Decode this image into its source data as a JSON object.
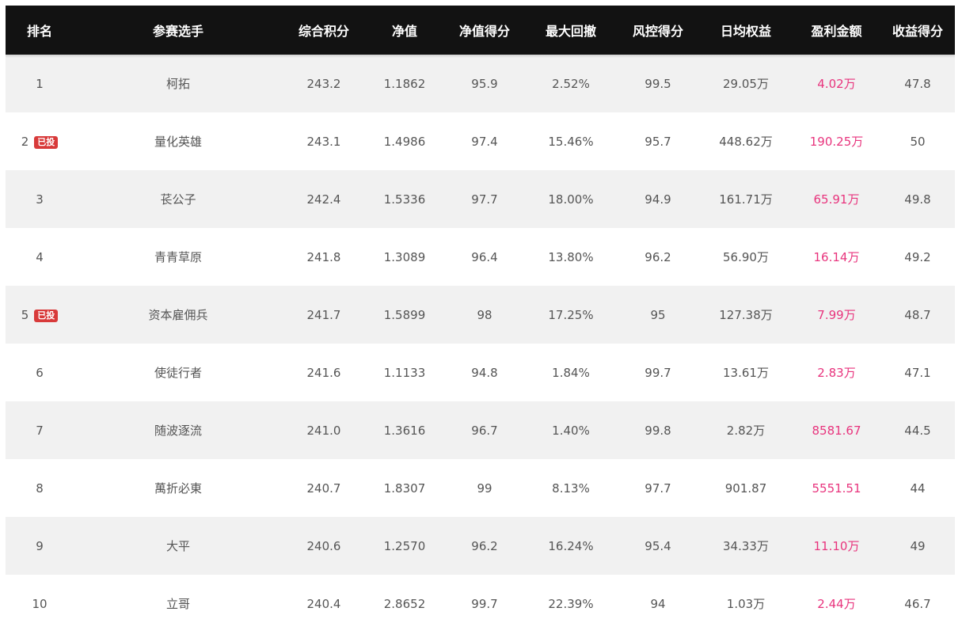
{
  "headers": [
    "排名",
    "参赛选手",
    "综合积分",
    "净值",
    "净值得分",
    "最大回撤",
    "风控得分",
    "日均权益",
    "盈利金额",
    "收益得分"
  ],
  "badge_label": "已投",
  "colors": {
    "header_bg": "#121212",
    "profit": "#e8347d",
    "badge": "#d83a3a",
    "row_alt": "#f1f1f1"
  },
  "rows": [
    {
      "rank": "1",
      "badge": false,
      "name": "柯拓",
      "score": "243.2",
      "nav": "1.1862",
      "nav_score": "95.9",
      "drawdown": "2.52%",
      "risk_score": "99.5",
      "avg_equity": "29.05万",
      "profit": "4.02万",
      "return_score": "47.8"
    },
    {
      "rank": "2",
      "badge": true,
      "name": "量化英雄",
      "score": "243.1",
      "nav": "1.4986",
      "nav_score": "97.4",
      "drawdown": "15.46%",
      "risk_score": "95.7",
      "avg_equity": "448.62万",
      "profit": "190.25万",
      "return_score": "50"
    },
    {
      "rank": "3",
      "badge": false,
      "name": "苌公子",
      "score": "242.4",
      "nav": "1.5336",
      "nav_score": "97.7",
      "drawdown": "18.00%",
      "risk_score": "94.9",
      "avg_equity": "161.71万",
      "profit": "65.91万",
      "return_score": "49.8"
    },
    {
      "rank": "4",
      "badge": false,
      "name": "青青草原",
      "score": "241.8",
      "nav": "1.3089",
      "nav_score": "96.4",
      "drawdown": "13.80%",
      "risk_score": "96.2",
      "avg_equity": "56.90万",
      "profit": "16.14万",
      "return_score": "49.2"
    },
    {
      "rank": "5",
      "badge": true,
      "name": "资本雇佣兵",
      "score": "241.7",
      "nav": "1.5899",
      "nav_score": "98",
      "drawdown": "17.25%",
      "risk_score": "95",
      "avg_equity": "127.38万",
      "profit": "7.99万",
      "return_score": "48.7"
    },
    {
      "rank": "6",
      "badge": false,
      "name": "使徒行者",
      "score": "241.6",
      "nav": "1.1133",
      "nav_score": "94.8",
      "drawdown": "1.84%",
      "risk_score": "99.7",
      "avg_equity": "13.61万",
      "profit": "2.83万",
      "return_score": "47.1"
    },
    {
      "rank": "7",
      "badge": false,
      "name": "随波逐流",
      "score": "241.0",
      "nav": "1.3616",
      "nav_score": "96.7",
      "drawdown": "1.40%",
      "risk_score": "99.8",
      "avg_equity": "2.82万",
      "profit": "8581.67",
      "return_score": "44.5"
    },
    {
      "rank": "8",
      "badge": false,
      "name": "萬折必東",
      "score": "240.7",
      "nav": "1.8307",
      "nav_score": "99",
      "drawdown": "8.13%",
      "risk_score": "97.7",
      "avg_equity": "901.87",
      "profit": "5551.51",
      "return_score": "44"
    },
    {
      "rank": "9",
      "badge": false,
      "name": "大平",
      "score": "240.6",
      "nav": "1.2570",
      "nav_score": "96.2",
      "drawdown": "16.24%",
      "risk_score": "95.4",
      "avg_equity": "34.33万",
      "profit": "11.10万",
      "return_score": "49"
    },
    {
      "rank": "10",
      "badge": false,
      "name": "立哥",
      "score": "240.4",
      "nav": "2.8652",
      "nav_score": "99.7",
      "drawdown": "22.39%",
      "risk_score": "94",
      "avg_equity": "1.03万",
      "profit": "2.44万",
      "return_score": "46.7"
    }
  ]
}
